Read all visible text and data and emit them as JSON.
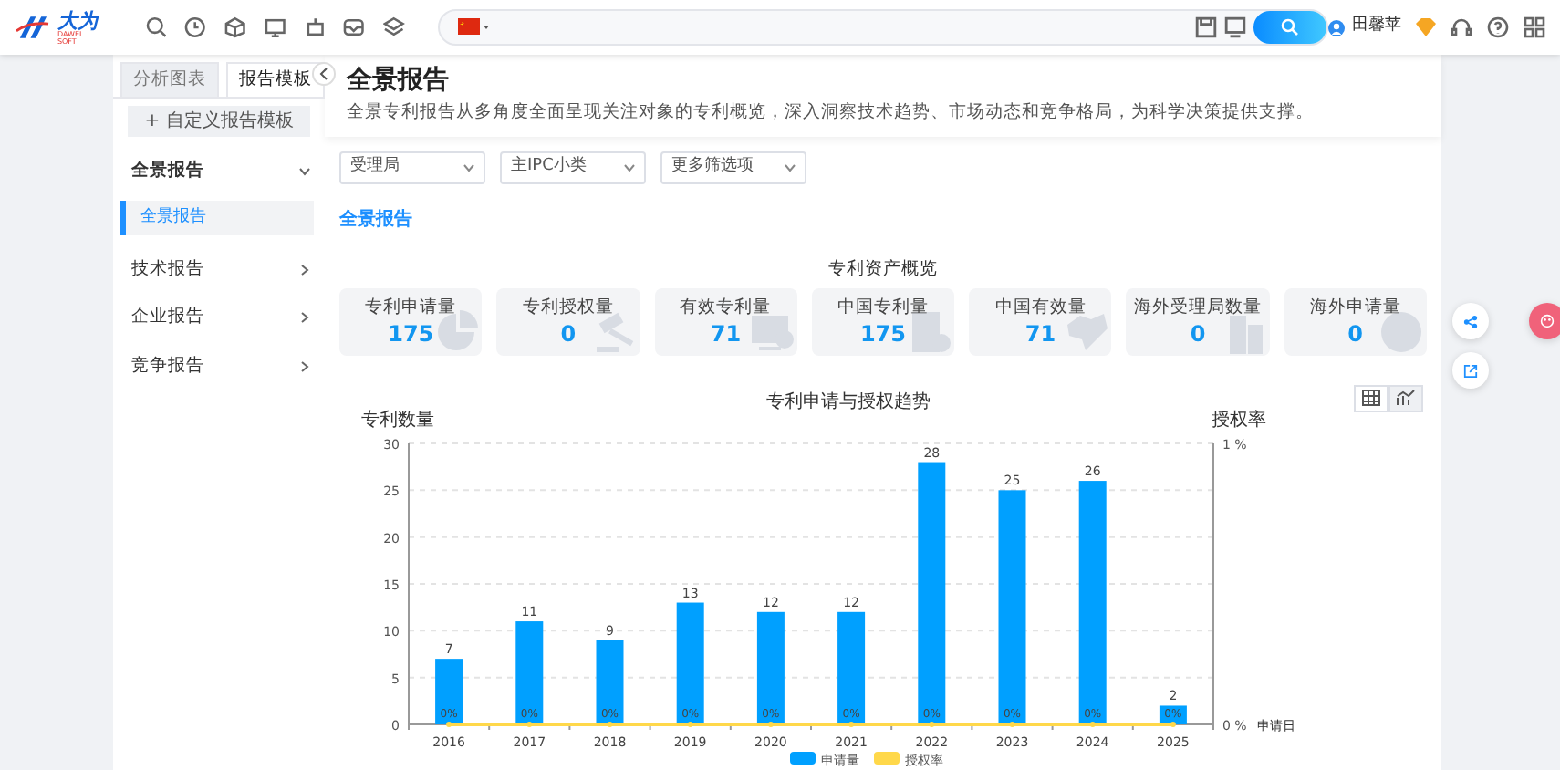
{
  "topbar": {
    "logo": {
      "name": "大为",
      "subtitle": "DAWEI SOFT"
    },
    "user": "田馨苹"
  },
  "sidebar": {
    "tabs": [
      {
        "label": "分析图表",
        "selected": false
      },
      {
        "label": "报告模板",
        "selected": true
      }
    ],
    "add_button": "+ 自定义报告模板",
    "groups": [
      {
        "label": "全景报告",
        "expanded": true,
        "children": [
          {
            "label": "全景报告",
            "selected": true
          }
        ]
      },
      {
        "label": "技术报告",
        "expanded": false
      },
      {
        "label": "企业报告",
        "expanded": false
      },
      {
        "label": "竞争报告",
        "expanded": false
      }
    ]
  },
  "header": {
    "title": "全景报告",
    "description": "全景专利报告从多角度全面呈现关注对象的专利概览，深入洞察技术趋势、市场动态和竞争格局，为科学决策提供支撑。"
  },
  "filters": [
    "受理局",
    "主IPC小类",
    "更多筛选项"
  ],
  "section_title": "全景报告",
  "overview": {
    "title": "专利资产概览",
    "stats": [
      {
        "label": "专利申请量",
        "value": "175"
      },
      {
        "label": "专利授权量",
        "value": "0"
      },
      {
        "label": "有效专利量",
        "value": "71"
      },
      {
        "label": "中国专利量",
        "value": "175"
      },
      {
        "label": "中国有效量",
        "value": "71"
      },
      {
        "label": "海外受理局数量",
        "value": "0"
      },
      {
        "label": "海外申请量",
        "value": "0"
      }
    ]
  },
  "chart_views": [
    {
      "selected": false
    },
    {
      "selected": true
    }
  ],
  "chart_data": {
    "type": "bar",
    "title": "专利申请与授权趋势",
    "ylabel": "专利数量",
    "xlabel": "申请日",
    "y2label": "授权率",
    "categories": [
      "2016",
      "2017",
      "2018",
      "2019",
      "2020",
      "2021",
      "2022",
      "2023",
      "2024",
      "2025"
    ],
    "series": [
      {
        "name": "申请量",
        "color": "#00a0ff",
        "values": [
          7,
          11,
          9,
          13,
          12,
          12,
          28,
          25,
          26,
          2
        ]
      },
      {
        "name": "授权率",
        "color": "#ffd84a",
        "values": [
          0,
          0,
          0,
          0,
          0,
          0,
          0,
          0,
          0,
          0
        ],
        "value_labels": [
          "0%",
          "0%",
          "0%",
          "0%",
          "0%",
          "0%",
          "0%",
          "0%",
          "0%",
          "0%"
        ]
      }
    ],
    "ylim": [
      0,
      30
    ],
    "yticks": [
      0,
      5,
      10,
      15,
      20,
      25,
      30
    ],
    "y2lim": [
      0,
      1
    ],
    "grid": true,
    "y2ticks": [
      {
        "value": 0,
        "label": "0 %"
      },
      {
        "value": 1,
        "label": "1 %"
      }
    ],
    "data_labels": true
  }
}
